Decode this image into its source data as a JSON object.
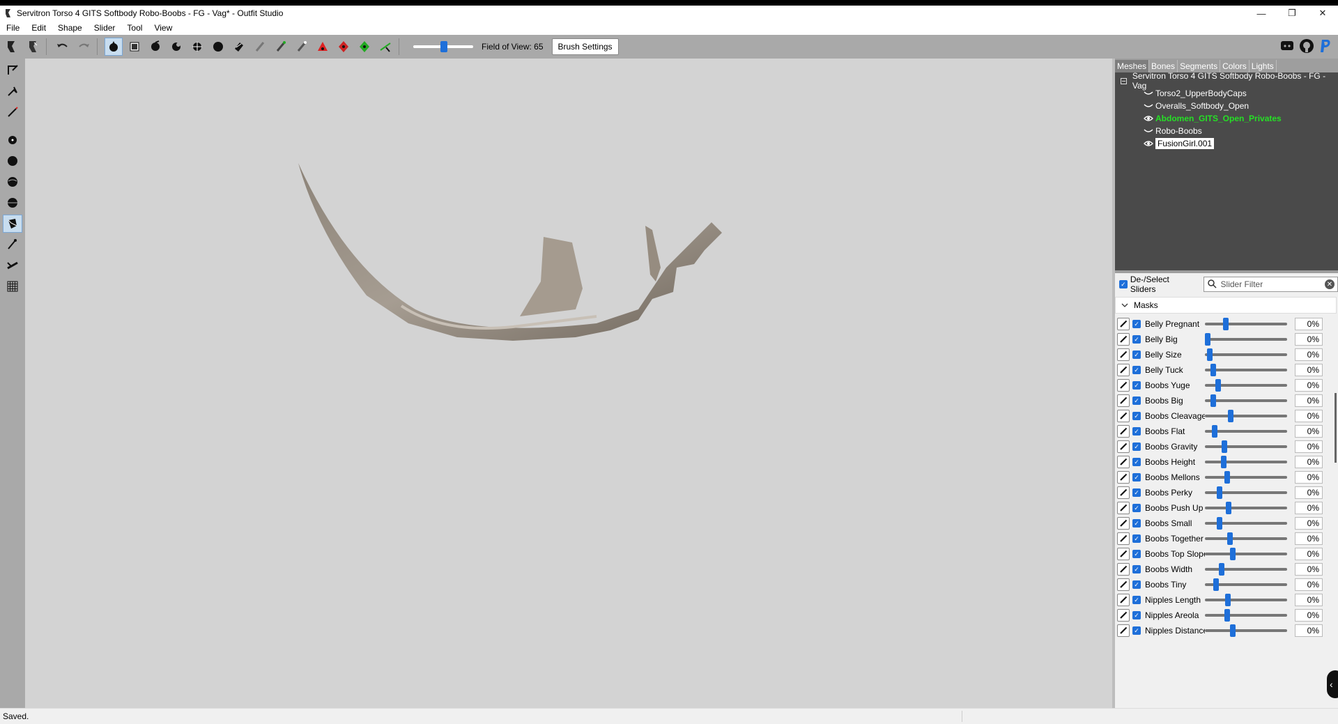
{
  "window": {
    "title": "Servitron Torso 4 GITS Softbody Robo-Boobs - FG - Vag* - Outfit Studio",
    "minimize_glyph": "—",
    "restore_glyph": "❐",
    "close_glyph": "✕"
  },
  "menu": [
    "File",
    "Edit",
    "Shape",
    "Slider",
    "Tool",
    "View"
  ],
  "toolbar": {
    "fov_label": "Field of View: 65",
    "fov_value": 65,
    "brush_settings_label": "Brush Settings"
  },
  "tabs": [
    "Meshes",
    "Bones",
    "Segments",
    "Colors",
    "Lights"
  ],
  "tree": {
    "root": "Servitron Torso 4 GITS Softbody Robo-Boobs - FG - Vag",
    "items": [
      {
        "label": "Torso2_UpperBodyCaps",
        "icon": "hidden-eye-icon"
      },
      {
        "label": "Overalls_Softbody_Open",
        "icon": "hidden-eye-icon"
      },
      {
        "label": "Abdomen_GITS_Open_Privates",
        "icon": "eye-icon"
      },
      {
        "label": "Robo-Boobs",
        "icon": "hidden-eye-icon"
      },
      {
        "label": "FusionGirl.001",
        "icon": "eye-icon"
      }
    ]
  },
  "sliders_panel": {
    "deselect_label": "De-/Select Sliders",
    "filter_placeholder": "Slider Filter",
    "group_label": "Masks",
    "sliders": [
      {
        "name": "Belly Pregnant",
        "value": "0%",
        "knob": 0.24
      },
      {
        "name": "Belly Big",
        "value": "0%",
        "knob": 0.0
      },
      {
        "name": "Belly Size",
        "value": "0%",
        "knob": 0.03
      },
      {
        "name": "Belly Tuck",
        "value": "0%",
        "knob": 0.07
      },
      {
        "name": "Boobs Yuge",
        "value": "0%",
        "knob": 0.14
      },
      {
        "name": "Boobs Big",
        "value": "0%",
        "knob": 0.07
      },
      {
        "name": "Boobs Cleavage",
        "value": "0%",
        "knob": 0.3
      },
      {
        "name": "Boobs Flat",
        "value": "0%",
        "knob": 0.09
      },
      {
        "name": "Boobs Gravity",
        "value": "0%",
        "knob": 0.22
      },
      {
        "name": "Boobs Height",
        "value": "0%",
        "knob": 0.21
      },
      {
        "name": "Boobs Mellons",
        "value": "0%",
        "knob": 0.25
      },
      {
        "name": "Boobs Perky",
        "value": "0%",
        "knob": 0.15
      },
      {
        "name": "Boobs Push Up",
        "value": "0%",
        "knob": 0.27
      },
      {
        "name": "Boobs Small",
        "value": "0%",
        "knob": 0.15
      },
      {
        "name": "Boobs Together",
        "value": "0%",
        "knob": 0.29
      },
      {
        "name": "Boobs Top Slope",
        "value": "0%",
        "knob": 0.33
      },
      {
        "name": "Boobs Width",
        "value": "0%",
        "knob": 0.18
      },
      {
        "name": "Boobs Tiny",
        "value": "0%",
        "knob": 0.11
      },
      {
        "name": "Nipples Length",
        "value": "0%",
        "knob": 0.26
      },
      {
        "name": "Nipples Areola",
        "value": "0%",
        "knob": 0.25
      },
      {
        "name": "Nipples Distance",
        "value": "0%",
        "knob": 0.33
      }
    ]
  },
  "status": {
    "text": "Saved."
  },
  "colors": {
    "accent": "#1e6fd9",
    "viewport": "#d3d3d3",
    "tree_bg": "#4a4a4a",
    "highlight_green": "#25e025"
  }
}
